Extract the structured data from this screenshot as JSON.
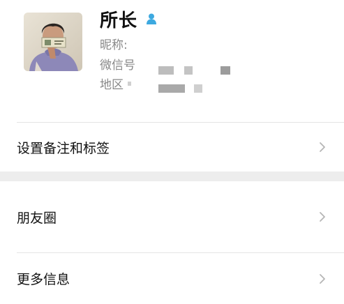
{
  "profile": {
    "name": "所长",
    "gender_icon": "male-user-icon",
    "nickname_label": "昵称:",
    "wechat_id_label": "微信号",
    "region_label": "地区",
    "avatar_description": "photo-avatar"
  },
  "menu": {
    "remarks_tags_label": "设置备注和标签",
    "moments_label": "朋友圈",
    "more_info_label": "更多信息"
  },
  "colors": {
    "accent_icon": "#3da9e0",
    "separator": "#ededed",
    "secondary_text": "#888888",
    "chevron": "#b5b5b5"
  }
}
